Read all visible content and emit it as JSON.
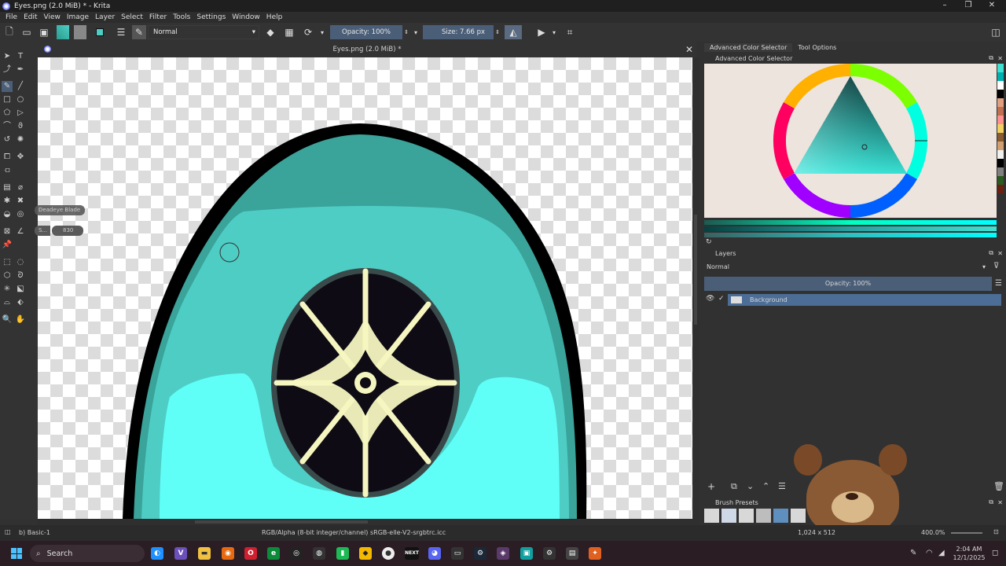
{
  "window": {
    "title": "Eyes.png (2.0 MiB) * - Krita"
  },
  "menu": [
    "File",
    "Edit",
    "View",
    "Image",
    "Layer",
    "Select",
    "Filter",
    "Tools",
    "Settings",
    "Window",
    "Help"
  ],
  "toolbar": {
    "blend_mode": "Normal",
    "opacity": "Opacity: 100%",
    "size": "Size: 7.66 px"
  },
  "document": {
    "tab_title": "Eyes.png (2.0 MiB) *"
  },
  "tool_hints": {
    "brush": "Deadeye Blade",
    "size": "830",
    "s": "S..."
  },
  "right": {
    "tabs": [
      "Advanced Color Selector",
      "Tool Options"
    ],
    "color_selector_title": "Advanced Color Selector",
    "layers_title": "Layers",
    "layers_blend": "Normal",
    "layers_opacity": "Opacity:  100%",
    "layer_name": "Background",
    "brush_presets_title": "Brush Presets"
  },
  "palette": [
    "#40e0d0",
    "#00b0b0",
    "#ffffff",
    "#000000",
    "#e0a080",
    "#c07050",
    "#ff9090",
    "#f0d060",
    "#8a5a30",
    "#d0a070",
    "#f0f0f0",
    "#000000",
    "#808080",
    "#2a5a20",
    "#6a2010"
  ],
  "status": {
    "brush": "b) Basic-1",
    "color_space": "RGB/Alpha (8-bit integer/channel)  sRGB-elle-V2-srgbtrc.icc",
    "dims": "1,024 x 512",
    "zoom": "400.0%"
  },
  "taskbar": {
    "search": "Search",
    "time": "2:04 AM",
    "date": "12/1/2025",
    "next_label": "NEXT"
  },
  "colors": {
    "teal": "#4ecdc4",
    "dark_teal": "#3aa39a",
    "cyan": "#5ffff8",
    "accent": "#4b5e78"
  }
}
